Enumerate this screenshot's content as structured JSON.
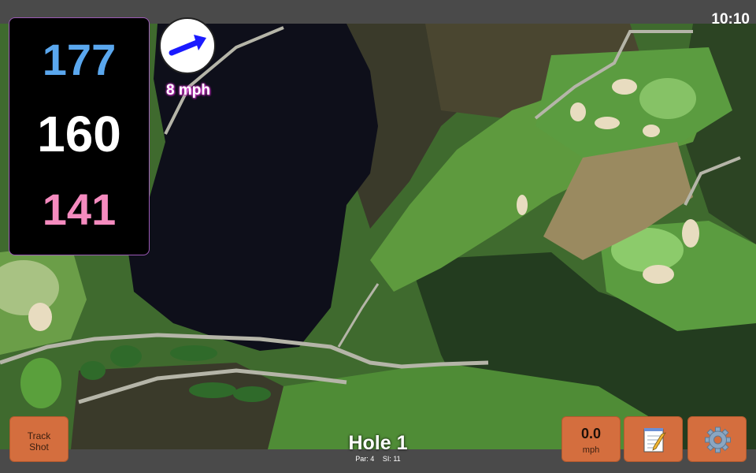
{
  "status_bar": {
    "time": "10:10"
  },
  "yardage": {
    "back": "177",
    "middle": "160",
    "front": "141"
  },
  "wind": {
    "speed_label": "8 mph",
    "direction_icon": "wind-arrow-icon"
  },
  "hole": {
    "title": "Hole 1",
    "par": "Par: 4",
    "stroke_index": "SI: 11"
  },
  "buttons": {
    "track_shot_line1": "Track",
    "track_shot_line2": "Shot",
    "speed_value": "0.0",
    "speed_unit": "mph",
    "notes_icon": "notepad-icon",
    "settings_icon": "gear-icon"
  },
  "colors": {
    "back_yardage": "#5aa7ee",
    "middle_yardage": "#ffffff",
    "front_yardage": "#f58bbf",
    "button_bg": "#d46e3e",
    "wind_arrow": "#1a1aff"
  }
}
